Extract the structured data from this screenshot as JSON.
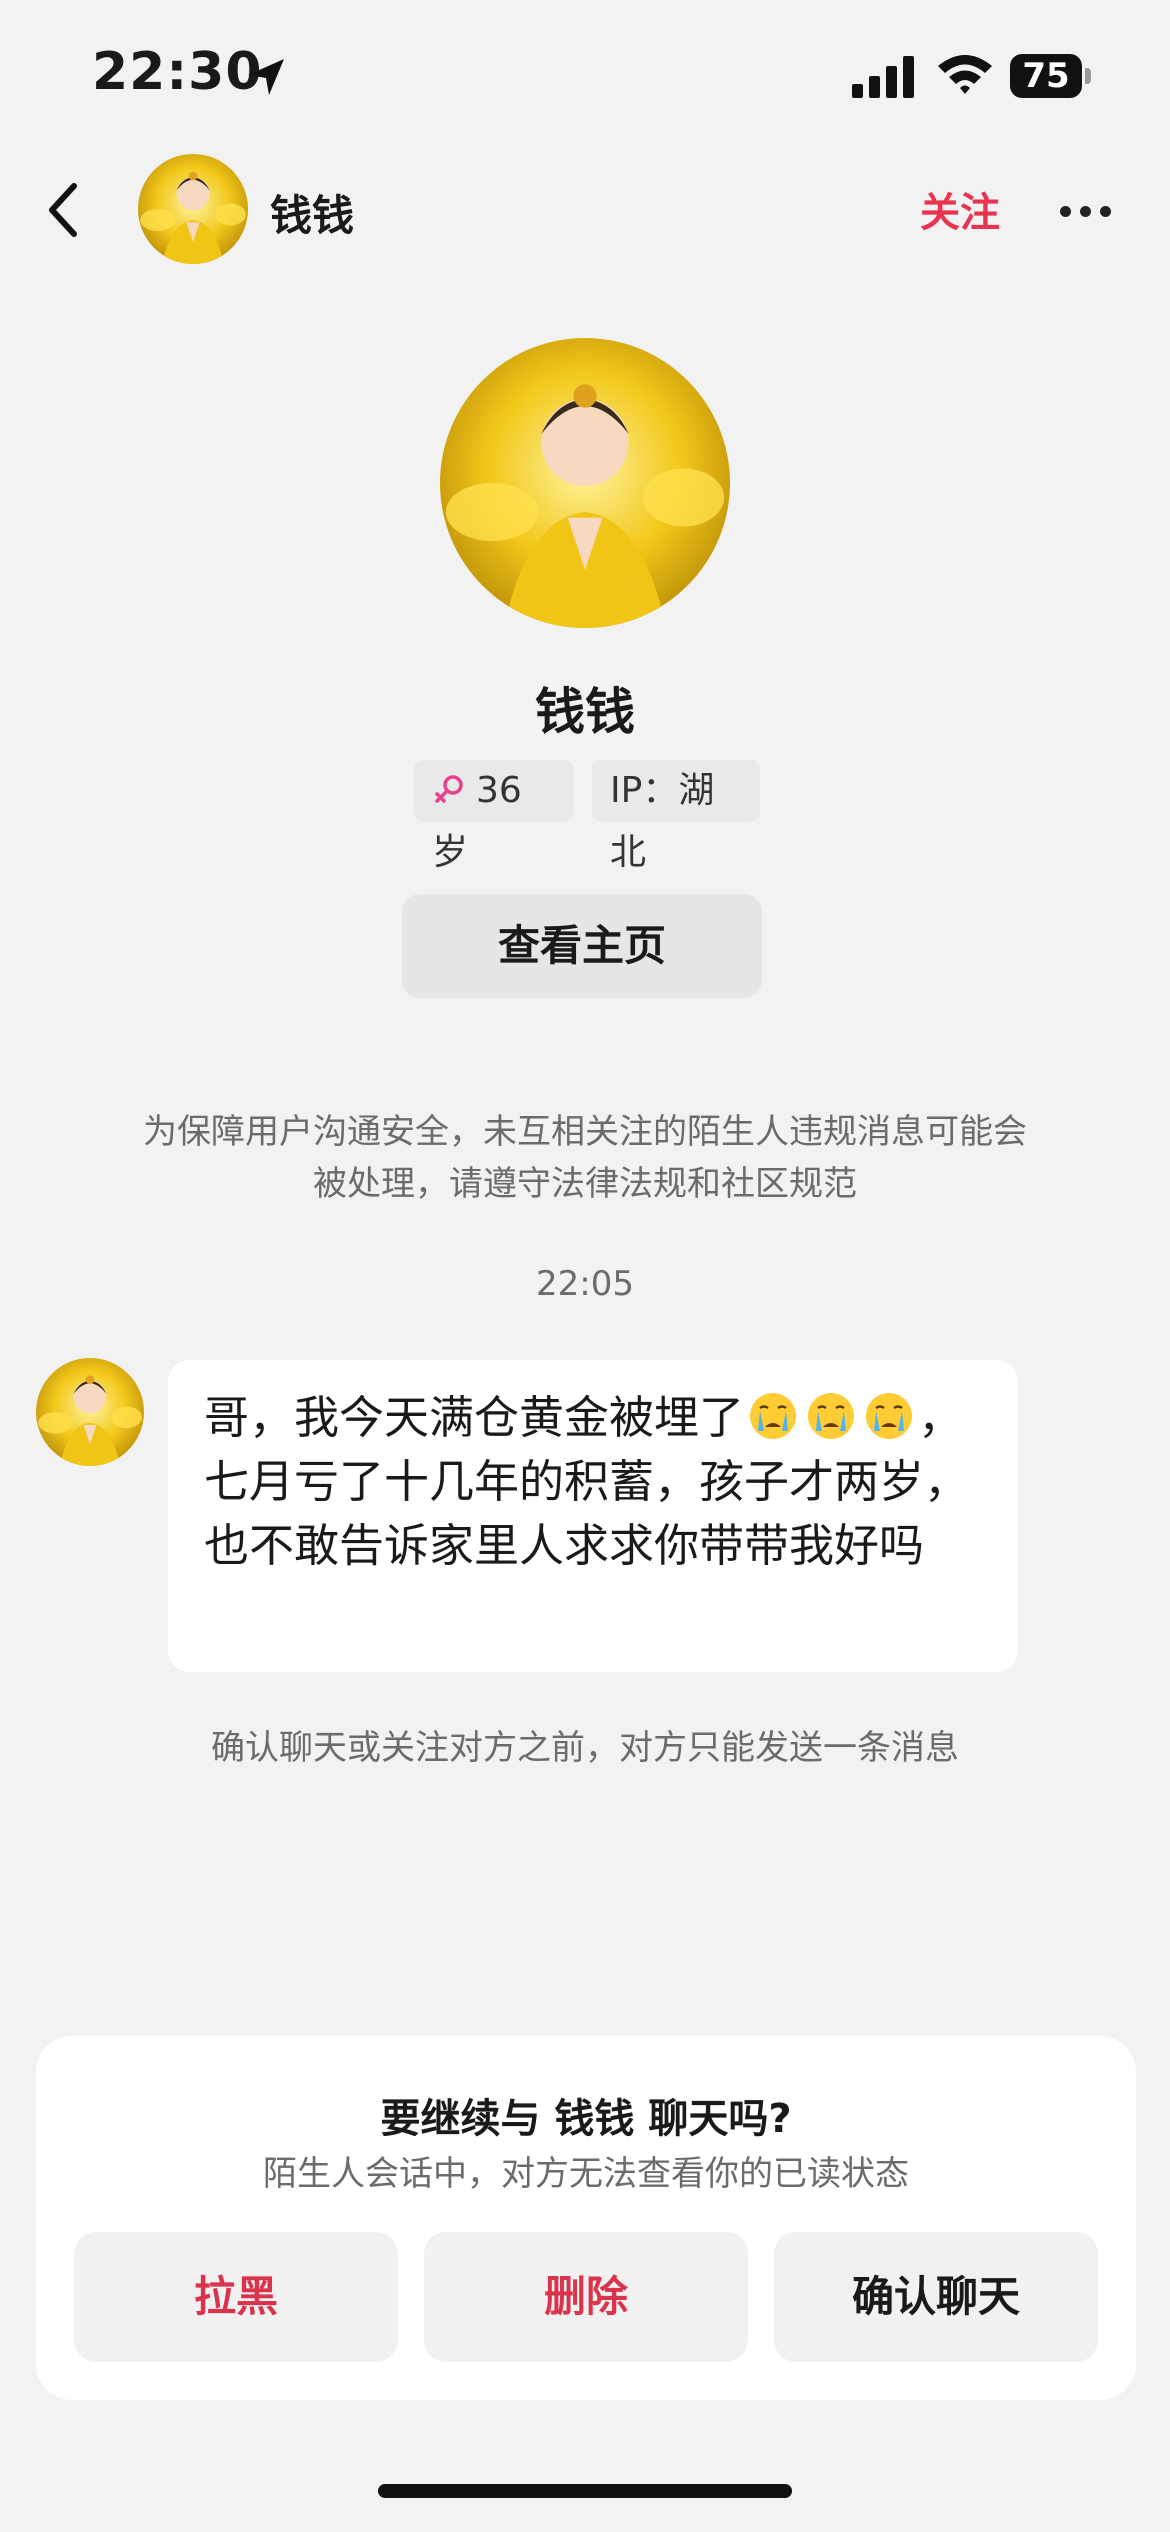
{
  "status_bar": {
    "time": "22:30",
    "battery": "75"
  },
  "nav": {
    "title": "钱钱",
    "follow": "关注"
  },
  "profile": {
    "name": "钱钱",
    "age": "36岁",
    "ip": "IP：湖北",
    "view_home": "查看主页"
  },
  "chat": {
    "safety_notice": "为保障用户沟通安全，未互相关注的陌生人违规消息可能会被处理，请遵守法律法规和社区规范",
    "timestamp": "22:05",
    "message_part1": "哥，我今天满仓黄金被埋了",
    "message_part2": "，七月亏了十几年的积蓄，孩子才两岁，也不敢告诉家里人求求你带带我好吗",
    "limit_note": "确认聊天或关注对方之前，对方只能发送一条消息"
  },
  "sheet": {
    "title": "要继续与 钱钱 聊天吗?",
    "subtitle": "陌生人会话中，对方无法查看你的已读状态",
    "block": "拉黑",
    "delete": "删除",
    "confirm": "确认聊天"
  },
  "colors": {
    "accent": "#e8344e",
    "background": "#f2f2f2"
  }
}
